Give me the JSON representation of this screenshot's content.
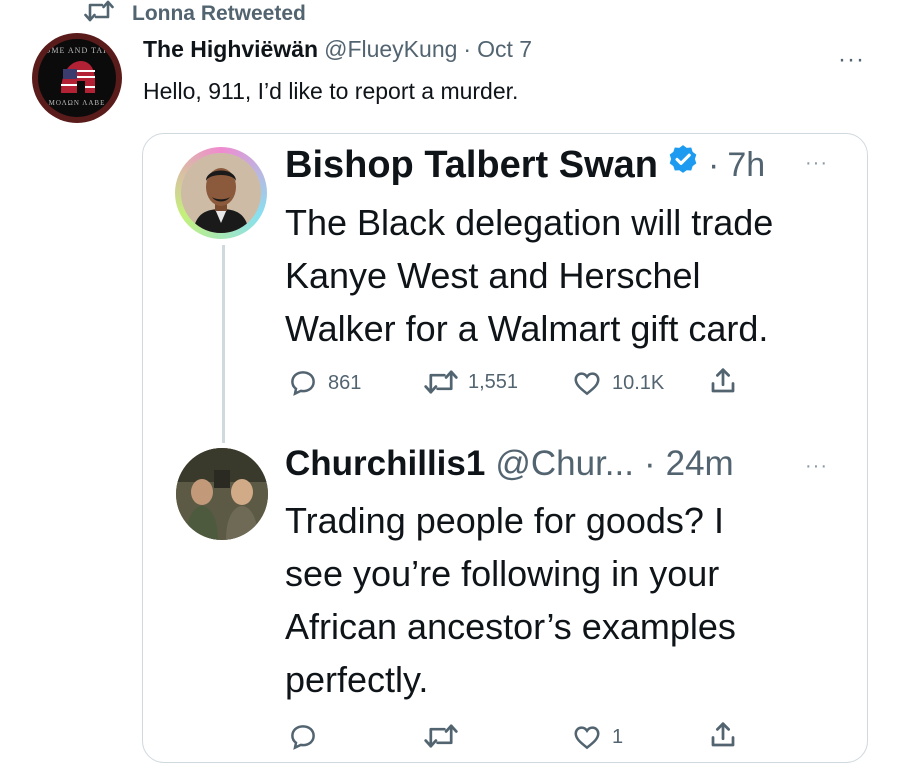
{
  "retweet": {
    "label": "Lonna Retweeted"
  },
  "outer_tweet": {
    "display_name": "The Highviëwän",
    "handle": "@FlueyKung",
    "separator": "·",
    "time": "Oct 7",
    "text": "Hello, 911, I’d like to report a murder.",
    "more": "···",
    "avatar_text_top": "COME AND TAKE",
    "avatar_text_bottom": "ΜΟΛΩΝ ΛΑΒΕ"
  },
  "quoted_thread": {
    "tweet1": {
      "display_name": "Bishop Talbert Swan",
      "separator": "·",
      "time": "7h",
      "more": "···",
      "lines": [
        "The Black delegation will trade",
        "Kanye West and Herschel",
        "Walker for a Walmart gift card."
      ],
      "actions": {
        "replies": "861",
        "retweets": "1,551",
        "likes": "10.1K"
      }
    },
    "tweet2": {
      "display_name": "Churchillis1",
      "handle": "@Chur...",
      "separator": "·",
      "time": "24m",
      "more": "···",
      "lines": [
        "Trading people for goods? I",
        "see you’re following in your",
        "African ancestor’s examples",
        "perfectly."
      ],
      "actions": {
        "replies": "",
        "retweets": "",
        "likes": "1"
      }
    }
  },
  "colors": {
    "text": "#0f1419",
    "muted": "#536471",
    "border": "#cfd9de",
    "verified": "#1d9bf0"
  },
  "icons": [
    "retweet-icon",
    "reply-icon",
    "like-icon",
    "share-icon",
    "verified-badge-icon",
    "more-icon"
  ]
}
